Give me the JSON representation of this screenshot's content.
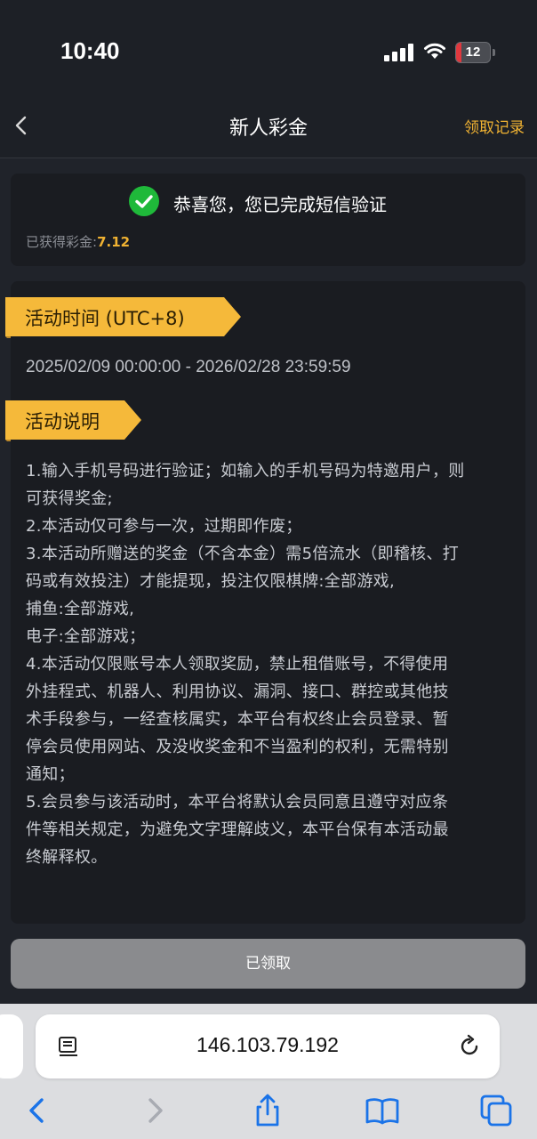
{
  "status_bar": {
    "time": "10:40",
    "battery": "12",
    "colors": {
      "battery_low": "#e0383e"
    }
  },
  "nav": {
    "title": "新人彩金",
    "record_link": "领取记录",
    "back_icon": "chevron-left-icon",
    "accent_color": "#f0b232"
  },
  "status_card": {
    "icon": "check-circle-icon",
    "message": "恭喜您，您已完成短信验证",
    "earned_label": "已获得彩金:",
    "earned_value": "7.12"
  },
  "activity": {
    "time_heading": "活动时间 (UTC+8)",
    "time_range": "2025/02/09 00:00:00 - 2026/02/28 23:59:59",
    "desc_heading": "活动说明",
    "desc_lines": [
      "1.输入手机号码进行验证；如输入的手机号码为特邀用户，则",
      "可获得奖金;",
      "2.本活动仅可参与一次，过期即作废；",
      "3.本活动所赠送的奖金（不含本金）需5倍流水（即稽核、打",
      "码或有效投注）才能提现，投注仅限棋牌:全部游戏,",
      "捕鱼:全部游戏,",
      "电子:全部游戏；",
      "4.本活动仅限账号本人领取奖励，禁止租借账号，不得使用",
      "外挂程式、机器人、利用协议、漏洞、接口、群控或其他技",
      "术手段参与，一经查核属实，本平台有权终止会员登录、暂",
      "停会员使用网站、及没收奖金和不当盈利的权利，无需特别",
      "通知；",
      "5.会员参与该活动时，本平台将默认会员同意且遵守对应条",
      "件等相关规定，为避免文字理解歧义，本平台保有本活动最",
      "终解释权。"
    ],
    "tag_color": "#f5b93a"
  },
  "claim_button": {
    "label": "已领取"
  },
  "browser": {
    "url": "146.103.79.192",
    "icons": [
      "reader-icon",
      "reload-icon",
      "back-arrow-icon",
      "forward-arrow-icon",
      "share-icon",
      "bookmarks-icon",
      "tabs-icon"
    ],
    "accent_color": "#1a73e8"
  }
}
